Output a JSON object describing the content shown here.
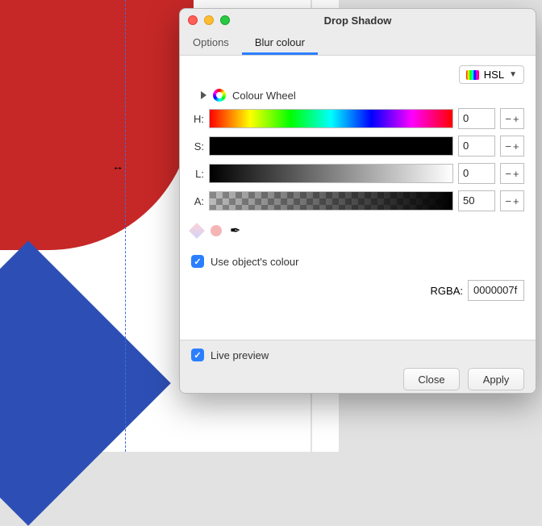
{
  "window": {
    "title": "Drop Shadow"
  },
  "tabs": {
    "options": "Options",
    "blur": "Blur colour",
    "active": "blur"
  },
  "mode": {
    "label": "HSL"
  },
  "colourWheel": {
    "label": "Colour Wheel"
  },
  "channels": {
    "h": {
      "label": "H:",
      "value": "0"
    },
    "s": {
      "label": "S:",
      "value": "0"
    },
    "l": {
      "label": "L:",
      "value": "0"
    },
    "a": {
      "label": "A:",
      "value": "50"
    }
  },
  "rgba": {
    "label": "RGBA:",
    "value": "0000007f"
  },
  "useObjectColour": {
    "label": "Use object's colour",
    "checked": true
  },
  "livePreview": {
    "label": "Live preview",
    "checked": true
  },
  "buttons": {
    "close": "Close",
    "apply": "Apply"
  }
}
